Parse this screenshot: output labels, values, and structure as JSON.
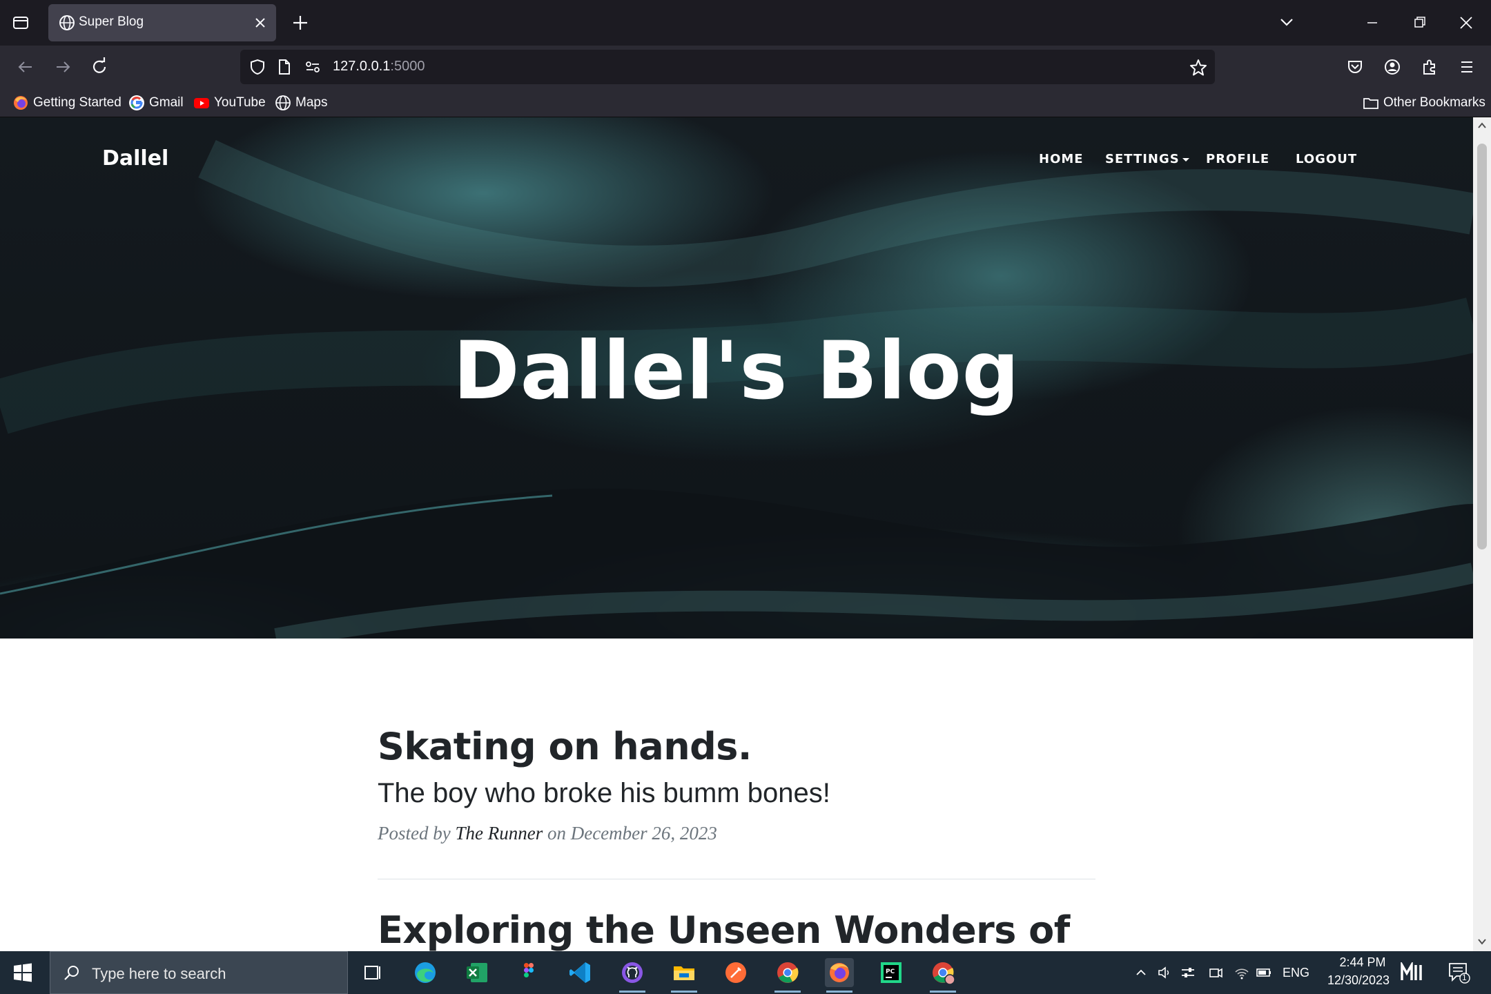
{
  "browser": {
    "tab_title": "Super Blog",
    "url_host": "127.0.0.1",
    "url_port": ":5000",
    "bookmarks": [
      {
        "label": "Getting Started",
        "icon": "firefox-icon"
      },
      {
        "label": "Gmail",
        "icon": "google-icon"
      },
      {
        "label": "YouTube",
        "icon": "youtube-icon"
      },
      {
        "label": "Maps",
        "icon": "globe-icon"
      }
    ],
    "other_bookmarks": "Other Bookmarks"
  },
  "site": {
    "brand": "Dallel",
    "nav": {
      "home": "HOME",
      "settings": "SETTINGS",
      "profile": "PROFILE",
      "logout": "LOGOUT"
    },
    "hero_title": "Dallel's Blog"
  },
  "posts": [
    {
      "title": "Skating on hands.",
      "subtitle": "The boy who broke his bumm bones!",
      "meta_prefix": "Posted by ",
      "author": "The Runner",
      "meta_suffix": " on December 26, 2023"
    },
    {
      "title": "Exploring the Unseen Wonders of"
    }
  ],
  "taskbar": {
    "search_placeholder": "Type here to search",
    "apps": [
      "task-view",
      "edge",
      "excel",
      "figma",
      "vscode",
      "github-desktop",
      "file-explorer",
      "postman",
      "chrome",
      "firefox",
      "pycharm",
      "chrome-profile"
    ],
    "language": "ENG",
    "time": "2:44 PM",
    "date": "12/30/2023",
    "notification_count": "1"
  },
  "colors": {
    "chrome_dark": "#1c1b22",
    "chrome_toolbar": "#2b2a33",
    "hero_teal": "#3f8a8e",
    "post_text": "#212529",
    "meta_gray": "#6c757d",
    "taskbar": "#1d2a36"
  }
}
